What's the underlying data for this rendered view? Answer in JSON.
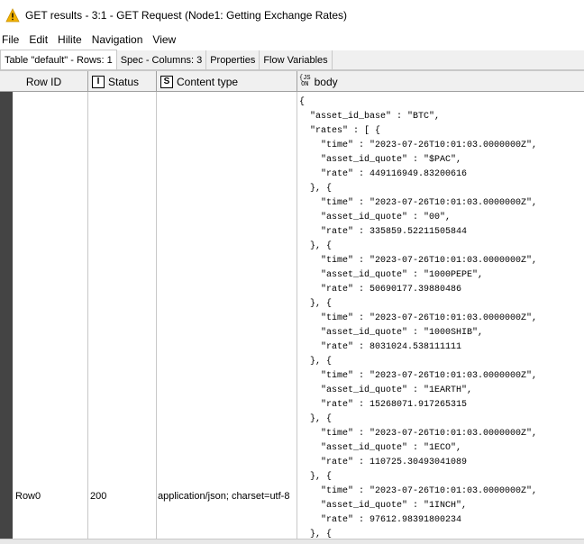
{
  "window": {
    "title": "GET results - 3:1 - GET Request (Node1: Getting Exchange Rates)",
    "warning_color": "#f2b200"
  },
  "menu": [
    "File",
    "Edit",
    "Hilite",
    "Navigation",
    "View"
  ],
  "tabs": [
    {
      "label": "Table \"default\" - Rows: 1",
      "active": true
    },
    {
      "label": "Spec - Columns: 3",
      "active": false
    },
    {
      "label": "Properties",
      "active": false
    },
    {
      "label": "Flow Variables",
      "active": false
    }
  ],
  "columns": [
    {
      "label": "Row ID",
      "type": ""
    },
    {
      "label": "Status",
      "type": "I"
    },
    {
      "label": "Content type",
      "type": "S"
    },
    {
      "label": "body",
      "type": "{JS ON"
    }
  ],
  "row": {
    "id": "Row0",
    "status": "200",
    "content_type": "application/json; charset=utf-8",
    "body_lines": [
      "{",
      "  \"asset_id_base\" : \"BTC\",",
      "  \"rates\" : [ {",
      "    \"time\" : \"2023-07-26T10:01:03.0000000Z\",",
      "    \"asset_id_quote\" : \"$PAC\",",
      "    \"rate\" : 449116949.83200616",
      "  }, {",
      "    \"time\" : \"2023-07-26T10:01:03.0000000Z\",",
      "    \"asset_id_quote\" : \"00\",",
      "    \"rate\" : 335859.52211505844",
      "  }, {",
      "    \"time\" : \"2023-07-26T10:01:03.0000000Z\",",
      "    \"asset_id_quote\" : \"1000PEPE\",",
      "    \"rate\" : 50690177.39880486",
      "  }, {",
      "    \"time\" : \"2023-07-26T10:01:03.0000000Z\",",
      "    \"asset_id_quote\" : \"1000SHIB\",",
      "    \"rate\" : 8031024.538111111",
      "  }, {",
      "    \"time\" : \"2023-07-26T10:01:03.0000000Z\",",
      "    \"asset_id_quote\" : \"1EARTH\",",
      "    \"rate\" : 15268071.917265315",
      "  }, {",
      "    \"time\" : \"2023-07-26T10:01:03.0000000Z\",",
      "    \"asset_id_quote\" : \"1ECO\",",
      "    \"rate\" : 110725.30493041089",
      "  }, {",
      "    \"time\" : \"2023-07-26T10:01:03.0000000Z\",",
      "    \"asset_id_quote\" : \"1INCH\",",
      "    \"rate\" : 97612.98391800234",
      "  }, {"
    ]
  }
}
